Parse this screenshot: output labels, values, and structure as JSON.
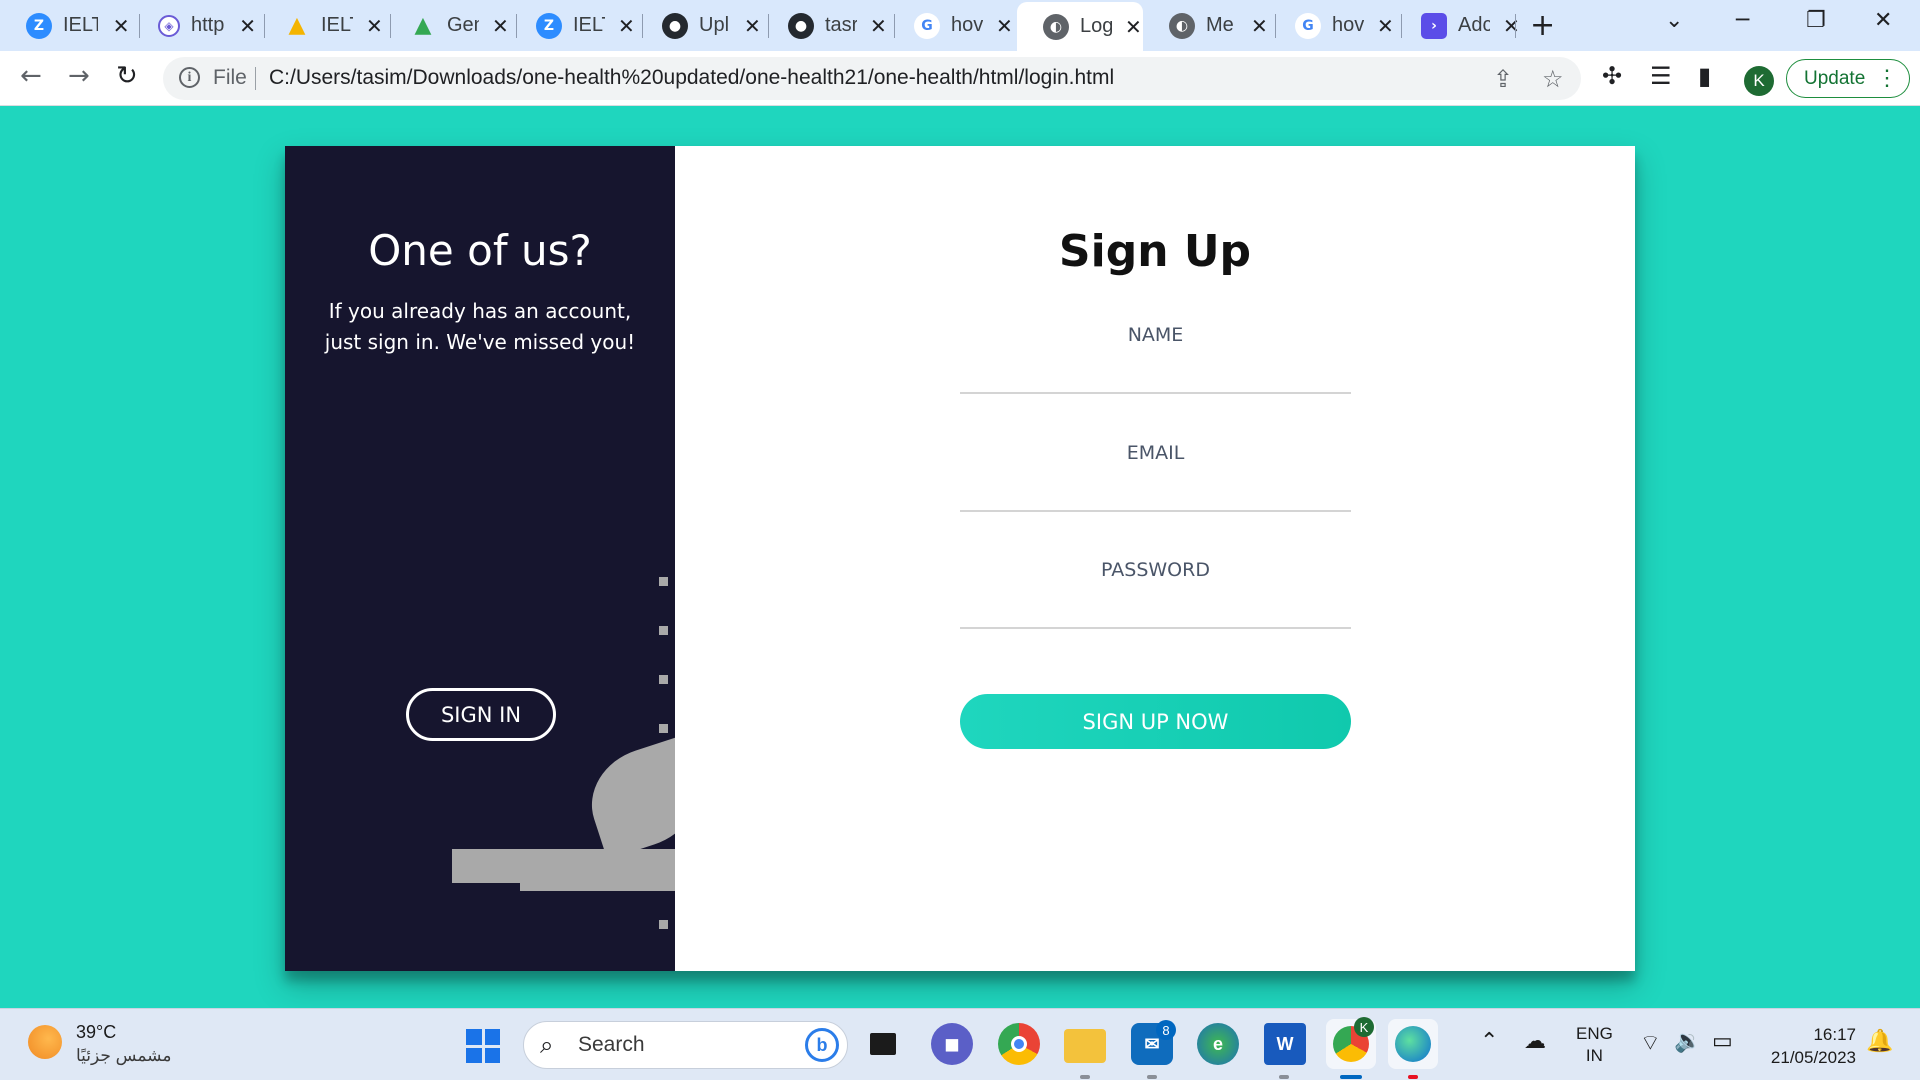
{
  "browser": {
    "tabs": [
      {
        "title": "IELT",
        "icon": "zoom-icon",
        "color": "#2d8cff",
        "glyph": "Z"
      },
      {
        "title": "http",
        "icon": "shield-icon",
        "color": "#6a5bd6",
        "glyph": "◈"
      },
      {
        "title": "IELT",
        "icon": "google-drive-icon",
        "color": "#f4b400",
        "glyph": "▲"
      },
      {
        "title": "Gen",
        "icon": "google-drive-icon",
        "color": "#34a853",
        "glyph": "▲"
      },
      {
        "title": "IELT",
        "icon": "zoom-icon",
        "color": "#2d8cff",
        "glyph": "Z"
      },
      {
        "title": "Upl",
        "icon": "github-icon",
        "color": "#24292f",
        "glyph": "●"
      },
      {
        "title": "tasr",
        "icon": "github-icon",
        "color": "#24292f",
        "glyph": "●"
      },
      {
        "title": "hov",
        "icon": "google-icon",
        "color": "#4285f4",
        "glyph": "G"
      },
      {
        "title": "Log",
        "icon": "globe-icon",
        "color": "#5f6368",
        "glyph": "◐",
        "active": true
      },
      {
        "title": "Me",
        "icon": "globe-icon",
        "color": "#5f6368",
        "glyph": "◐"
      },
      {
        "title": "hov",
        "icon": "google-icon",
        "color": "#4285f4",
        "glyph": "G"
      },
      {
        "title": "Adc",
        "icon": "terminal-icon",
        "color": "#5b4de8",
        "glyph": "›"
      }
    ],
    "address": {
      "scheme_label": "File",
      "url": "C:/Users/tasim/Downloads/one-health%20updated/one-health21/one-health/html/login.html"
    },
    "profile_initial": "K",
    "update_label": "Update"
  },
  "page": {
    "overlay": {
      "title": "One of us?",
      "text": "If you already has an account, just sign in. We've missed you!",
      "button": "SIGN IN"
    },
    "form": {
      "title": "Sign Up",
      "fields": [
        {
          "label": "NAME"
        },
        {
          "label": "EMAIL"
        },
        {
          "label": "PASSWORD"
        }
      ],
      "submit": "SIGN UP NOW"
    },
    "colors": {
      "background": "#1fd6be",
      "overlay": "#16152e",
      "accent": "#1fd6be"
    }
  },
  "taskbar": {
    "weather": {
      "temp": "39°C",
      "desc": "مشمس جزئيًا"
    },
    "search_placeholder": "Search",
    "mail_badge": "8",
    "chrome_badge": "K",
    "lang_line1": "ENG",
    "lang_line2": "IN",
    "time": "16:17",
    "date": "21/05/2023"
  }
}
